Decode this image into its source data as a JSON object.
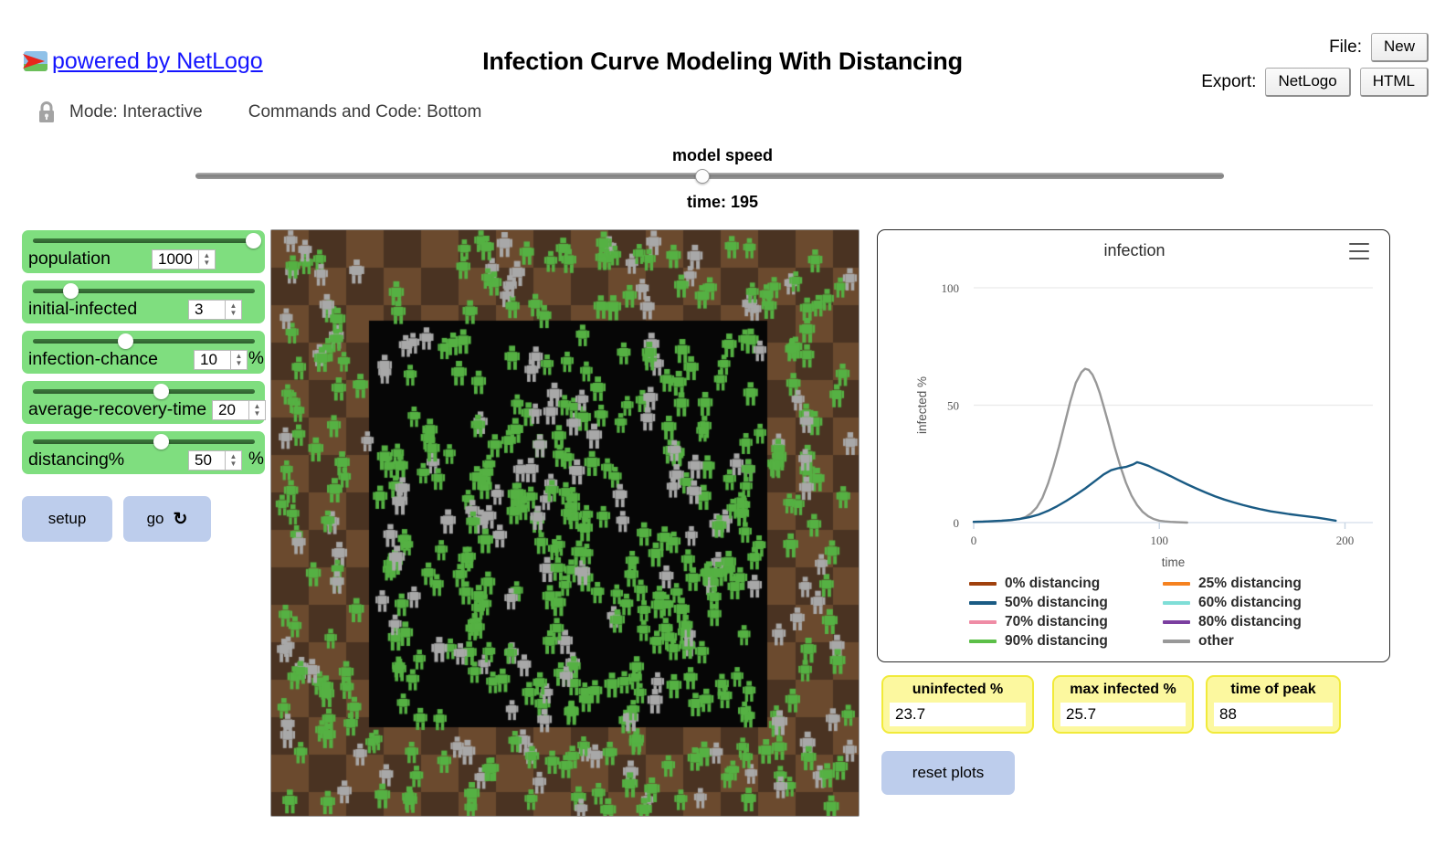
{
  "header": {
    "netlogo_link": "powered by NetLogo",
    "netlogo_logo_icon": "netlogo-flag-icon",
    "title": "Infection Curve Modeling With Distancing",
    "lock_icon": "lock-icon",
    "mode_text": "Mode: Interactive",
    "commands_text": "Commands and Code: Bottom",
    "file_label": "File:",
    "file_new_button": "New",
    "export_label": "Export:",
    "export_netlogo_button": "NetLogo",
    "export_html_button": "HTML"
  },
  "speed": {
    "label": "model speed",
    "time_label": "time: 195",
    "knob_percent": 49.3
  },
  "sliders": [
    {
      "name": "population",
      "value": "1000",
      "unit": "",
      "knob_percent": 99,
      "value_left": 142,
      "pct_left": 0
    },
    {
      "name": "initial-infected",
      "value": "3",
      "unit": "",
      "knob_percent": 17,
      "value_left": 182,
      "pct_left": 0
    },
    {
      "name": "infection-chance",
      "value": "10",
      "unit": "%",
      "knob_percent": 41.5,
      "value_left": 188,
      "pct_left": 248
    },
    {
      "name": "average-recovery-time",
      "value": "20",
      "unit": "",
      "knob_percent": 57.5,
      "value_left": 208,
      "pct_left": 0
    },
    {
      "name": "distancing%",
      "value": "50",
      "unit": "%",
      "knob_percent": 57.5,
      "value_left": 182,
      "pct_left": 248
    }
  ],
  "buttons": {
    "setup": "setup",
    "go": "go",
    "go_loop_icon": "loop-icon",
    "reset_plots": "reset plots"
  },
  "world": {
    "name": "simulation-world-view",
    "background_color": "#5a3d26",
    "inner_region_color": "#060606",
    "healthy_agent_color": "#55b143",
    "recovered_agent_color": "#a8a8a8"
  },
  "monitors": [
    {
      "label": "uninfected %",
      "value": "23.7"
    },
    {
      "label": "max infected %",
      "value": "25.7"
    },
    {
      "label": "time of peak",
      "value": "88"
    }
  ],
  "chart_data": {
    "type": "line",
    "title": "infection",
    "menu_icon": "hamburger-menu-icon",
    "xlabel": "time",
    "ylabel": "infected %",
    "xlim": [
      0,
      215
    ],
    "ylim": [
      0,
      100
    ],
    "xticks": [
      0,
      100,
      200
    ],
    "yticks": [
      0,
      50,
      100
    ],
    "grid": true,
    "legend_position": "bottom",
    "legend": [
      {
        "name": "0% distancing",
        "color": "#a0410d"
      },
      {
        "name": "25% distancing",
        "color": "#f58220"
      },
      {
        "name": "50% distancing",
        "color": "#1a5b84"
      },
      {
        "name": "60% distancing",
        "color": "#7fded7"
      },
      {
        "name": "70% distancing",
        "color": "#ef8ca5"
      },
      {
        "name": "80% distancing",
        "color": "#7b3fa0"
      },
      {
        "name": "90% distancing",
        "color": "#5cbf48"
      },
      {
        "name": "other",
        "color": "#989898"
      }
    ],
    "series": [
      {
        "name": "other",
        "color": "#989898",
        "x": [
          0,
          5,
          10,
          15,
          20,
          25,
          28,
          31,
          34,
          37,
          40,
          43,
          46,
          49,
          52,
          55,
          58,
          60,
          62,
          64,
          66,
          68,
          70,
          73,
          76,
          79,
          82,
          85,
          88,
          91,
          94,
          97,
          100,
          103,
          106,
          109,
          112,
          115
        ],
        "y": [
          0.3,
          0.4,
          0.5,
          0.7,
          1.0,
          1.6,
          2.4,
          4.0,
          6.5,
          10.5,
          16.5,
          24.0,
          32.5,
          42.0,
          51.5,
          59.5,
          64.0,
          65.5,
          65.0,
          63.0,
          59.5,
          55.0,
          49.5,
          41.0,
          32.0,
          24.0,
          17.0,
          11.5,
          7.5,
          4.6,
          2.7,
          1.5,
          0.8,
          0.5,
          0.3,
          0.2,
          0.1,
          0.0
        ]
      },
      {
        "name": "50% distancing",
        "color": "#1a5b84",
        "x": [
          0,
          5,
          10,
          15,
          20,
          25,
          30,
          35,
          40,
          45,
          50,
          55,
          60,
          65,
          70,
          74,
          78,
          82,
          86,
          88,
          90,
          94,
          98,
          102,
          106,
          110,
          115,
          120,
          125,
          130,
          135,
          140,
          145,
          150,
          155,
          160,
          165,
          170,
          175,
          180,
          185,
          190,
          195
        ],
        "y": [
          0.3,
          0.4,
          0.6,
          0.8,
          1.1,
          1.6,
          2.3,
          3.4,
          5.0,
          7.0,
          9.3,
          11.8,
          14.5,
          17.5,
          20.5,
          22.3,
          23.2,
          23.7,
          24.8,
          25.7,
          25.3,
          24.2,
          22.7,
          21.3,
          19.8,
          18.2,
          16.3,
          14.5,
          12.8,
          11.2,
          9.8,
          8.6,
          7.5,
          6.5,
          5.6,
          4.8,
          4.2,
          3.6,
          3.1,
          2.6,
          2.1,
          1.5,
          0.8
        ]
      }
    ]
  }
}
